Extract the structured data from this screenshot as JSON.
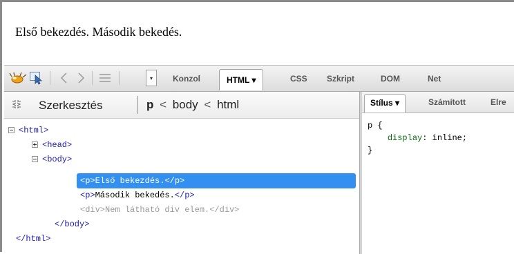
{
  "preview": {
    "text": "Első bekezdés. Második bekedés."
  },
  "toolbar": {
    "icons": [
      "firebug-icon",
      "inspect-icon",
      "back-icon",
      "forward-icon",
      "lines-icon",
      "menu-arrow-icon"
    ],
    "tabs": [
      {
        "label": "Konzol"
      },
      {
        "label": "HTML ▾",
        "active": true
      },
      {
        "label": "CSS"
      },
      {
        "label": "Szkript"
      },
      {
        "label": "DOM"
      },
      {
        "label": "Net"
      }
    ]
  },
  "html_panel": {
    "breadcrumb": {
      "edit_label": "Szerkesztés",
      "path_current": "p",
      "path_rest_1": "body",
      "path_rest_2": "html",
      "separator": "<"
    },
    "tree": [
      {
        "open": "<html>"
      },
      {
        "open": "<head>"
      },
      {
        "open": "<body>"
      },
      {
        "open": "<p>",
        "text": "Első bekezdés.",
        "close": "</p>",
        "selected": true
      },
      {
        "open": "<p>",
        "text": "Második bekedés.",
        "close": "</p>"
      },
      {
        "open": "<div>",
        "text": "Nem látható div elem.",
        "close": "</div>"
      },
      {
        "close": "</body>"
      },
      {
        "close": "</html>"
      }
    ]
  },
  "side_panel": {
    "tabs": [
      {
        "label": "Stílus ▾",
        "active": true
      },
      {
        "label": "Számított"
      },
      {
        "label": "Elre"
      }
    ],
    "css": {
      "selector": "p {",
      "property": "display",
      "value": "inline;",
      "close": "}"
    }
  },
  "colors": {
    "selection": "#3390f0",
    "tag": "#1b1bb5",
    "css_property": "#0b6b10"
  }
}
